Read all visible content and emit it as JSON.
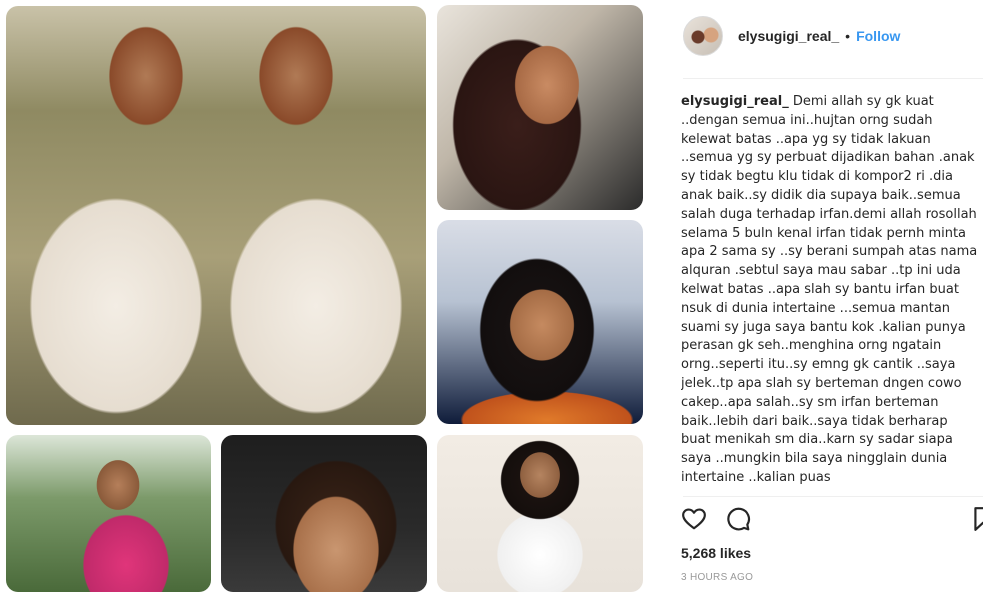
{
  "post": {
    "images": [
      {
        "description": "main-collage-photo"
      },
      {
        "description": "selfie-top"
      },
      {
        "description": "selfie-middle"
      },
      {
        "description": "outdoor-dress"
      },
      {
        "description": "closeup-face"
      },
      {
        "description": "white-shirt-pose"
      }
    ]
  },
  "header": {
    "username": "elysugigi_real_",
    "separator": "•",
    "follow_label": "Follow"
  },
  "caption": {
    "username": "elysugigi_real_",
    "text": " Demi allah sy gk kuat ..dengan semua ini..hujtan orng sudah kelewat batas ..apa yg sy tidak lakuan ..semua yg sy perbuat dijadikan bahan .anak sy tidak begtu klu tidak di kompor2 ri .dia anak baik..sy didik dia supaya baik..semua salah duga terhadap irfan.demi allah rosollah selama 5 buln kenal irfan tidak pernh minta apa 2 sama sy ..sy berani sumpah atas nama alquran .sebtul saya mau sabar ..tp ini uda kelwat batas ..apa slah sy bantu irfan buat nsuk di dunia intertaine ...semua mantan suami sy juga saya bantu kok .kalian punya perasan gk seh..menghina orng ngatain orng..seperti itu..sy emng gk cantik ..saya jelek..tp apa slah sy berteman dngen cowo cakep..apa salah..sy sm irfan berteman baik..lebih dari baik..saya tidak berharap buat menikah sm dia..karn sy sadar siapa saya ..mungkin bila saya ningglain dunia intertaine ..kalian puas"
  },
  "actions": {
    "like_icon": "heart-icon",
    "comment_icon": "comment-icon",
    "save_icon": "bookmark-icon"
  },
  "likes": "5,268 likes",
  "timestamp": "3 HOURS AGO",
  "colors": {
    "link": "#3897f0",
    "text": "#262626",
    "muted": "#999999"
  }
}
